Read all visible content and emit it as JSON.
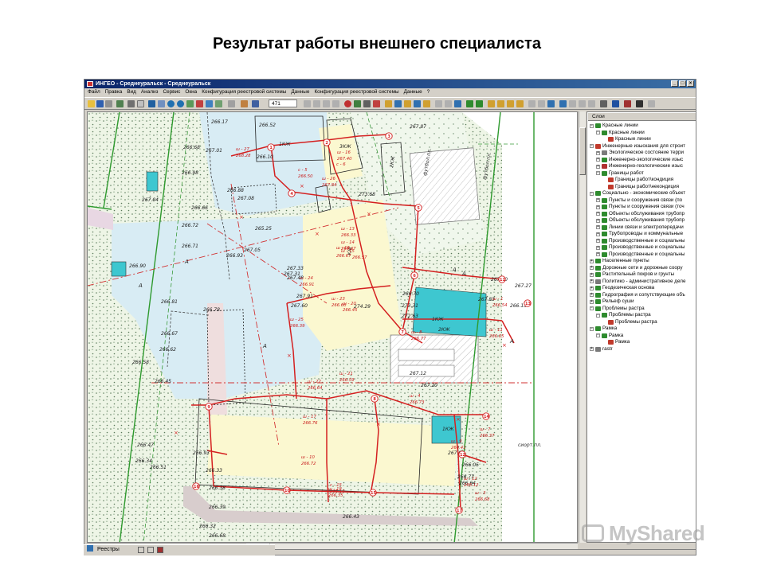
{
  "slide": {
    "title": "Результат работы внешнего специалиста"
  },
  "window": {
    "title": "ИНГЕО - Среднеуральск - Среднеуральск"
  },
  "menu": [
    "Файл",
    "Правка",
    "Вид",
    "Анализ",
    "Сервис",
    "Окна",
    "Конфигурация реестровой системы",
    "Данные",
    "Конфигурация реестровой системы",
    "Данные",
    "?"
  ],
  "toolbar": {
    "zoom_value": "471"
  },
  "layers_panel": {
    "tab_label": "Слои",
    "nodes": [
      {
        "label": "Красные линии",
        "level": 0,
        "color": "#2e8b2e"
      },
      {
        "label": "Красные линии",
        "level": 1,
        "color": "#2e8b2e"
      },
      {
        "label": "Красные линии",
        "level": 2,
        "color": "#c0392b"
      },
      {
        "label": "Инженерные изыскания для строит",
        "level": 0,
        "color": "#c0392b"
      },
      {
        "label": "Экологическое состояние терри",
        "level": 1,
        "color": "#7a7a7a"
      },
      {
        "label": "Инженерно-экологические изыс",
        "level": 1,
        "color": "#2e8b2e"
      },
      {
        "label": "Инженерно-геологические изыс",
        "level": 1,
        "color": "#b03030"
      },
      {
        "label": "Границы работ",
        "level": 1,
        "color": "#2e8b2e"
      },
      {
        "label": "Границы работ\\кондиция",
        "level": 2,
        "color": "#c0392b"
      },
      {
        "label": "Границы работ\\некондиция",
        "level": 2,
        "color": "#c0392b"
      },
      {
        "label": "Социально - экономические объект",
        "level": 0,
        "color": "#2e8b2e"
      },
      {
        "label": "Пункты и сооружения связи (по",
        "level": 1,
        "color": "#2e8b2e"
      },
      {
        "label": "Пункты и сооружения связи (точ",
        "level": 1,
        "color": "#2e8b2e"
      },
      {
        "label": "Объекты обслуживания трубопр",
        "level": 1,
        "color": "#2e8b2e"
      },
      {
        "label": "Объекты обслуживания трубопр",
        "level": 1,
        "color": "#2e8b2e"
      },
      {
        "label": "Линии связи и электропередачи",
        "level": 1,
        "color": "#2e8b2e"
      },
      {
        "label": "Трубопроводы и коммунальные",
        "level": 1,
        "color": "#2e8b2e"
      },
      {
        "label": "Производственные и социальны",
        "level": 1,
        "color": "#2e8b2e"
      },
      {
        "label": "Производственные и социальны",
        "level": 1,
        "color": "#2e8b2e"
      },
      {
        "label": "Производственные и социальны",
        "level": 1,
        "color": "#2e8b2e"
      },
      {
        "label": "Населенные пункты",
        "level": 0,
        "color": "#2e8b2e"
      },
      {
        "label": "Дорожные сети и дорожные соору",
        "level": 0,
        "color": "#2e8b2e"
      },
      {
        "label": "Растительный покров и грунты",
        "level": 0,
        "color": "#2e8b2e"
      },
      {
        "label": "Политико - административное деле",
        "level": 0,
        "color": "#7a7a7a"
      },
      {
        "label": "Геодезическая основа",
        "level": 0,
        "color": "#2e8b2e"
      },
      {
        "label": "Гидрография и сопутствующие объ",
        "level": 0,
        "color": "#2e8b2e"
      },
      {
        "label": "Рельеф суши",
        "level": 0,
        "color": "#2e8b2e"
      },
      {
        "label": "Проблемы растра",
        "level": 0,
        "color": "#2e8b2e"
      },
      {
        "label": "Проблемы растра",
        "level": 1,
        "color": "#2e8b2e"
      },
      {
        "label": "Проблемы растра",
        "level": 2,
        "color": "#c0392b"
      },
      {
        "label": "Рамка",
        "level": 0,
        "color": "#2e8b2e"
      },
      {
        "label": "Рамка",
        "level": 1,
        "color": "#2e8b2e"
      },
      {
        "label": "Рамка",
        "level": 2,
        "color": "#c0392b"
      },
      {
        "label": "rastr",
        "level": 0,
        "color": "#7a7a7a"
      }
    ]
  },
  "map": {
    "building_labels": [
      "1КЖ",
      "3КЖ",
      "2КЖ",
      "КЖ",
      "2КЖ",
      "1КЖ",
      "1КЖ"
    ],
    "zone_labels": [
      "А",
      "А",
      "А",
      "А",
      "А",
      "А"
    ],
    "elevations": [
      "266.17",
      "266.52",
      "266.68",
      "267.01",
      "266.10",
      "266.98",
      "267.04",
      "266.88",
      "266.66",
      "266.72",
      "266.71",
      "266.90",
      "267.08",
      "267.05",
      "266.93",
      "265.25",
      "266.81",
      "266.78",
      "266.67",
      "266.62",
      "266.58",
      "266.45",
      "266.47",
      "266.34",
      "266.51",
      "266.93",
      "266.33",
      "266.38",
      "266.39",
      "266.32",
      "266.68",
      "267.31",
      "267.48",
      "267.33",
      "267.60",
      "267.91",
      "273.68",
      "274.29",
      "273.31",
      "272.63",
      "266.70",
      "267.83",
      "267.27",
      "266.13",
      "267.12",
      "267.20",
      "267.04",
      "266.77",
      "266.64",
      "267.20",
      "266.05",
      "266.43",
      "267.87"
    ],
    "point_numbers": [
      "1",
      "2",
      "3",
      "4",
      "5",
      "6",
      "7",
      "8",
      "9",
      "10",
      "11",
      "12",
      "13",
      "14",
      "15",
      "16",
      "17"
    ],
    "well_codes": [
      "ш - 27",
      "ш - 16",
      "с - 5",
      "ш - 26",
      "ш - 13",
      "ш - 19",
      "ш - 15",
      "ш - 14",
      "ш - 24",
      "ш - 23",
      "ш - 20",
      "ш - 25",
      "ш - 22",
      "ш - 21",
      "ш - 17",
      "ш - 10",
      "ш - 18",
      "ш - 1",
      "ш - 11",
      "ш - 8",
      "ш - 4",
      "ш - 7",
      "ш - 9",
      "ш - 12",
      "ш - 3",
      "с - 6",
      "с - 15"
    ],
    "well_values": [
      "268.28",
      "267.40",
      "266.50",
      "267.84",
      "266.33",
      "266.67",
      "266.57",
      "266.47",
      "266.91",
      "266.60",
      "266.45",
      "266.39",
      "266.64",
      "266.59",
      "266.76",
      "266.72",
      "266.35",
      "266.54",
      "266.65",
      "266.77",
      "266.73",
      "266.37",
      "266.41",
      "266.12",
      "266.68",
      "266.10"
    ],
    "text_notes": [
      "футбол.пл.",
      "футбол.пл.",
      "сиорт.пл."
    ]
  },
  "statusbar": {
    "text": "Реестры"
  },
  "watermark": {
    "text": "MyShared"
  }
}
